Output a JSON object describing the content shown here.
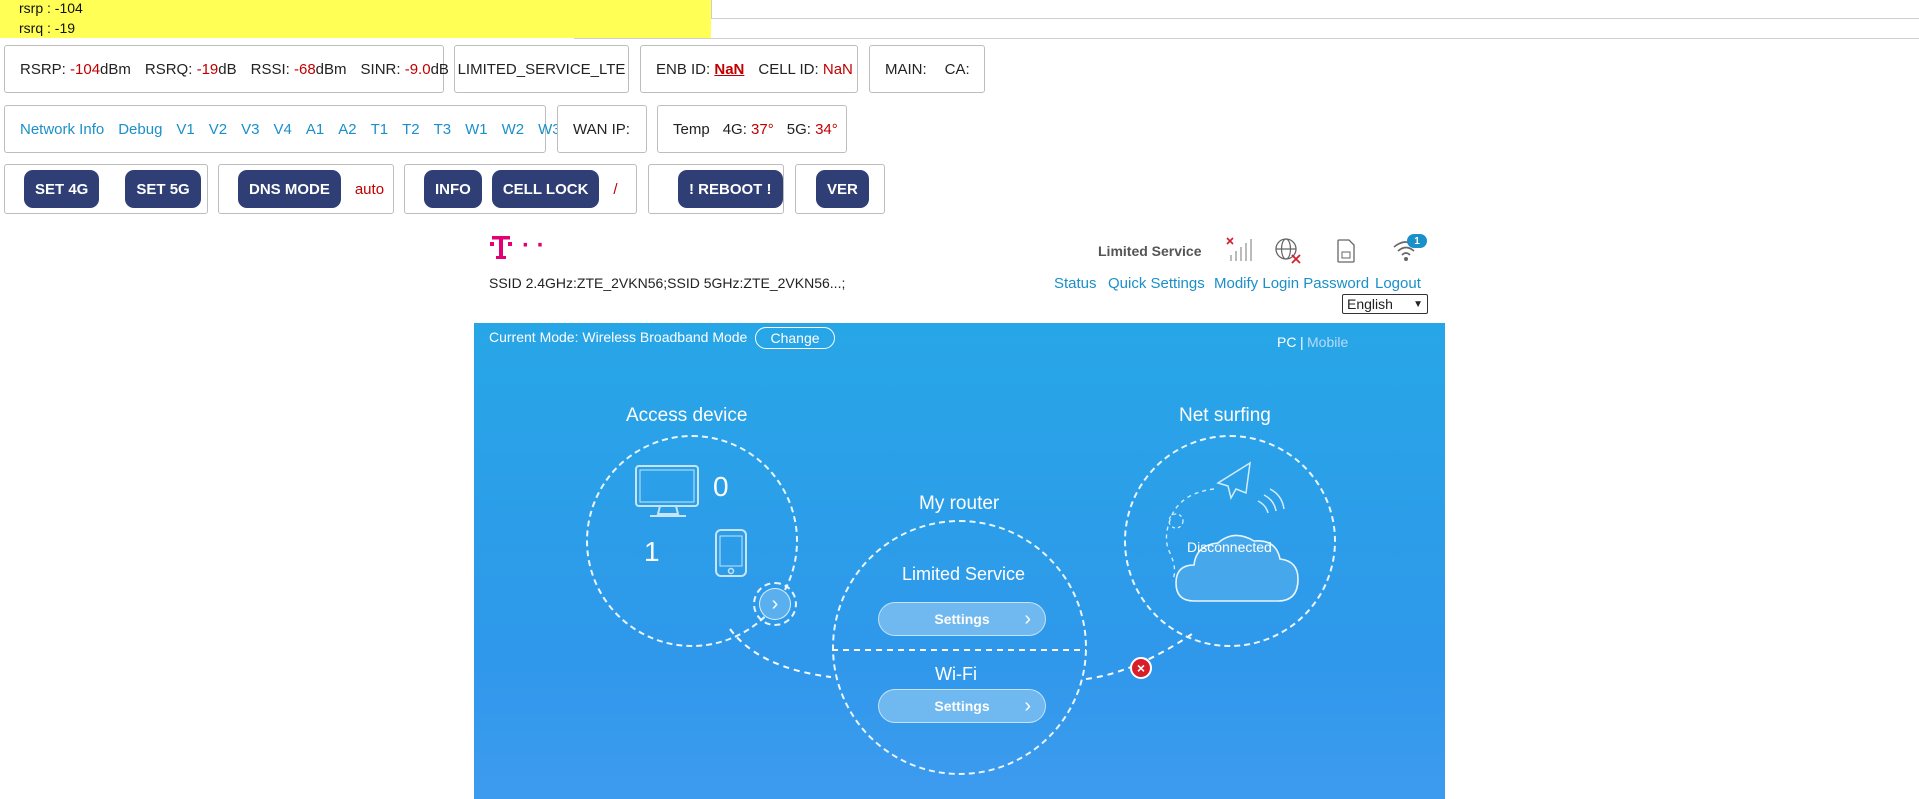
{
  "debug": {
    "rsrp_line": "rsrp : -104",
    "rsrq_line": "rsrq : -19"
  },
  "signal": {
    "rsrp_label": "RSRP:",
    "rsrp_value": "-104",
    "rsrp_unit": "dBm",
    "rsrq_label": "RSRQ:",
    "rsrq_value": "-19",
    "rsrq_unit": "dB",
    "rssi_label": "RSSI:",
    "rssi_value": "-68",
    "rssi_unit": "dBm",
    "sinr_label": "SINR:",
    "sinr_value": "-9.0",
    "sinr_unit": "dB"
  },
  "service_status": "LIMITED_SERVICE_LTE",
  "enb": {
    "enb_label": "ENB ID:",
    "enb_value": "NaN",
    "cell_label": "CELL ID:",
    "cell_value": "NaN"
  },
  "carrier": {
    "main_label": "MAIN:",
    "ca_label": "CA:"
  },
  "nav_links": [
    "Network Info",
    "Debug",
    "V1",
    "V2",
    "V3",
    "V4",
    "A1",
    "A2",
    "T1",
    "T2",
    "T3",
    "W1",
    "W2",
    "W3"
  ],
  "wan": {
    "label": "WAN IP:"
  },
  "temp": {
    "label": "Temp",
    "g4_label": "4G:",
    "g4_value": "37°",
    "g5_label": "5G:",
    "g5_value": "34°"
  },
  "actions": {
    "set4g": "SET 4G",
    "set5g": "SET 5G",
    "dns_mode": "DNS MODE",
    "dns_value": "auto",
    "info": "INFO",
    "cell_lock": "CELL LOCK",
    "cell_lock_value": "/",
    "reboot": "! REBOOT !",
    "ver": "VER"
  },
  "router": {
    "brand_dots": "· ·",
    "ssid_text": "SSID 2.4GHz:ZTE_2VKN56;SSID 5GHz:ZTE_2VKN56...;",
    "status_text": "Limited Service",
    "wifi_badge": "1",
    "links": {
      "status": "Status",
      "quick": "Quick Settings",
      "modify": "Modify Login Password",
      "logout": "Logout"
    },
    "language": "English",
    "mode_text": "Current Mode: Wireless Broadband Mode",
    "change_label": "Change",
    "pc_label": "PC",
    "sep": "|",
    "mobile_label": "Mobile",
    "access_title": "Access device",
    "pc_count": "0",
    "mobile_count": "1",
    "my_router_title": "My router",
    "router_status": "Limited Service",
    "settings_label": "Settings",
    "wifi_title": "Wi-Fi",
    "wifi_settings_label": "Settings",
    "net_title": "Net surfing",
    "net_status": "Disconnected"
  },
  "colors": {
    "accent_link": "#1a8fc9",
    "pill": "#2f3e74",
    "brand": "#e20074",
    "panel": "#2f98ea",
    "alert": "#d81e28"
  }
}
